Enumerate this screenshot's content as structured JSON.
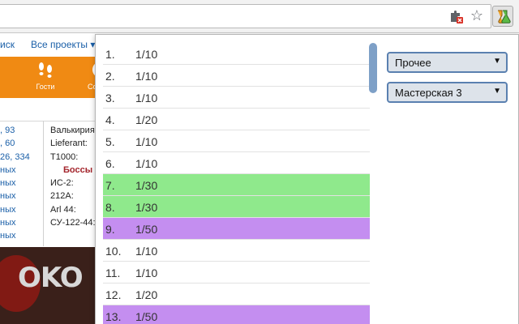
{
  "browser": {
    "address": ""
  },
  "page": {
    "nav": {
      "search": "иск",
      "projects": "Все проекты ▾"
    },
    "header": {
      "guests": "Гости",
      "partial": "Со"
    },
    "left_numbers": [
      ", 93",
      ", 60",
      "26, 334",
      "ных",
      "ных",
      "ных",
      "ных",
      "ных",
      "ных"
    ],
    "middle_labels": [
      "Валькирия:",
      "Lieferant:",
      "T1000:",
      "Боссы",
      "ИС-2:",
      "212A:",
      "Arl 44:",
      "СУ-122-44:"
    ],
    "banner_text": "OKO"
  },
  "popup": {
    "rows": [
      {
        "num": "1.",
        "val": "1/10",
        "color": "#ffffff"
      },
      {
        "num": "2.",
        "val": "1/10",
        "color": "#ffffff"
      },
      {
        "num": "3.",
        "val": "1/10",
        "color": "#ffffff"
      },
      {
        "num": "4.",
        "val": "1/20",
        "color": "#ffffff"
      },
      {
        "num": "5.",
        "val": "1/10",
        "color": "#ffffff"
      },
      {
        "num": "6.",
        "val": "1/10",
        "color": "#ffffff"
      },
      {
        "num": "7.",
        "val": "1/30",
        "color": "#8fe98c"
      },
      {
        "num": "8.",
        "val": "1/30",
        "color": "#8fe98c"
      },
      {
        "num": "9.",
        "val": "1/50",
        "color": "#c48ef0"
      },
      {
        "num": "10.",
        "val": "1/10",
        "color": "#ffffff"
      },
      {
        "num": "11.",
        "val": "1/10",
        "color": "#ffffff"
      },
      {
        "num": "12.",
        "val": "1/20",
        "color": "#ffffff"
      },
      {
        "num": "13.",
        "val": "1/50",
        "color": "#c48ef0"
      }
    ],
    "select_category": "Прочее",
    "select_workshop": "Мастерская 3"
  },
  "colors": {
    "accent_orange": "#f08a13",
    "select_border": "#5a80b0"
  }
}
